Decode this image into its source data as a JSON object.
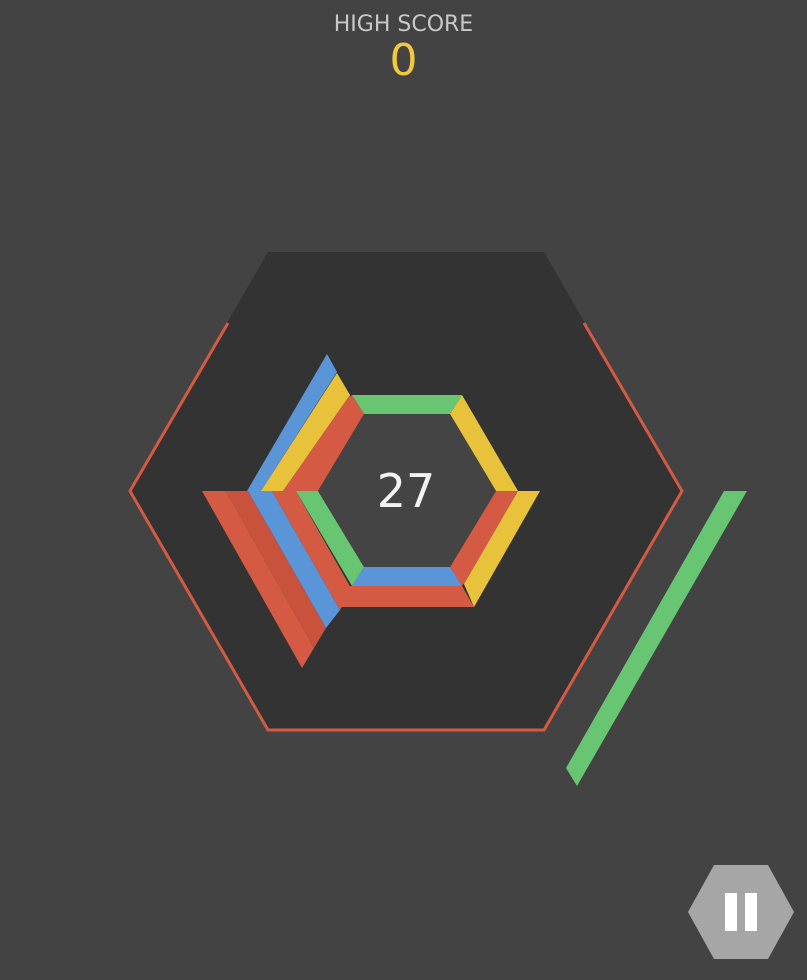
{
  "hud": {
    "high_score_label": "HIGH SCORE",
    "high_score_value": "0"
  },
  "center": {
    "score": "27"
  },
  "colors": {
    "background": "#434343",
    "arena": "#333333",
    "red": "#d45a44",
    "yellow": "#e8c23a",
    "blue": "#5a95d8",
    "green": "#68c672",
    "gold_text": "#f3c93c",
    "pause_button": "#a6a6a6"
  },
  "icons": {
    "pause": "pause-icon"
  }
}
